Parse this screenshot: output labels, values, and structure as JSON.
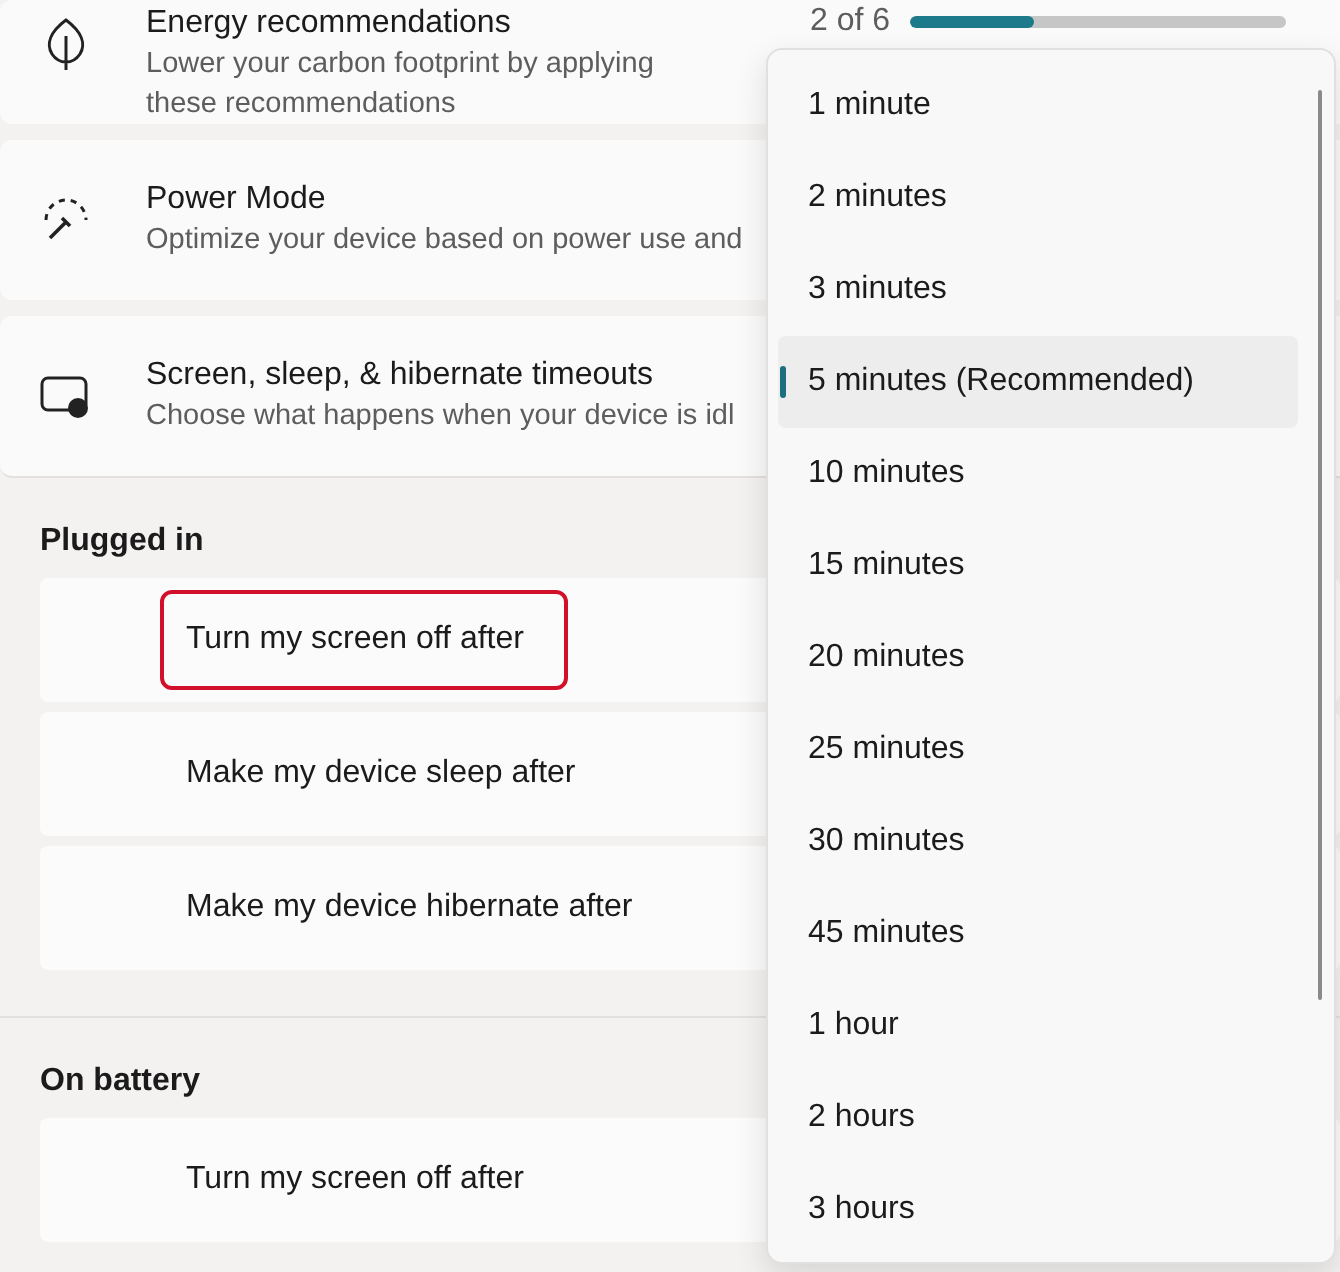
{
  "cards": [
    {
      "kind": "leaf",
      "title": "Energy recommendations",
      "description": "Lower your carbon footprint by applying these recommendations",
      "progress_text": "2 of 6",
      "level": 0.33
    },
    {
      "kind": "gauge",
      "title": "Power Mode",
      "description": "Optimize your device based on power use and"
    },
    {
      "kind": "screen",
      "title": "Screen, sleep, & hibernate timeouts",
      "description": "Choose what happens when your device is idl"
    }
  ],
  "sections": [
    {
      "title": "Plugged in",
      "rows": [
        {
          "label": "Turn my screen off after",
          "highlighted": true
        },
        {
          "label": "Make my device sleep after",
          "highlighted": false
        },
        {
          "label": "Make my device hibernate after",
          "highlighted": false
        }
      ]
    },
    {
      "title": "On battery",
      "rows": [
        {
          "label": "Turn my screen off after",
          "highlighted": false
        }
      ]
    }
  ],
  "dropdown": {
    "options": [
      {
        "label": "1 minute",
        "selected": false
      },
      {
        "label": "2 minutes",
        "selected": false
      },
      {
        "label": "3 minutes",
        "selected": false
      },
      {
        "label": "5 minutes (Recommended)",
        "selected": true
      },
      {
        "label": "10 minutes",
        "selected": false
      },
      {
        "label": "15 minutes",
        "selected": false
      },
      {
        "label": "20 minutes",
        "selected": false
      },
      {
        "label": "25 minutes",
        "selected": false
      },
      {
        "label": "30 minutes",
        "selected": false
      },
      {
        "label": "45 minutes",
        "selected": false
      },
      {
        "label": "1 hour",
        "selected": false
      },
      {
        "label": "2 hours",
        "selected": false
      },
      {
        "label": "3 hours",
        "selected": false
      }
    ]
  }
}
